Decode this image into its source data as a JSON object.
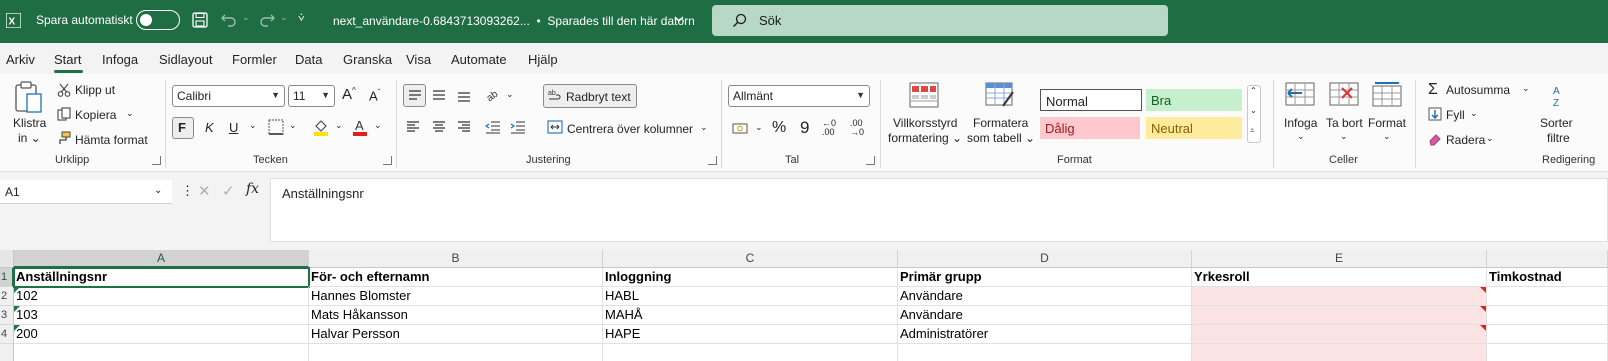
{
  "titlebar": {
    "autosave_label": "Spara automatiskt",
    "filename": "next_användare-0.6843713093262...",
    "save_status": "Sparades till den här datorn",
    "search_placeholder": "Sök"
  },
  "tabs": [
    "Arkiv",
    "Start",
    "Infoga",
    "Sidlayout",
    "Formler",
    "Data",
    "Granska",
    "Visa",
    "Automate",
    "Hjälp"
  ],
  "ribbon": {
    "clipboard": {
      "paste_label_1": "Klistra",
      "paste_label_2": "in",
      "cut": "Klipp ut",
      "copy": "Kopiera",
      "format_painter": "Hämta format",
      "group": "Urklipp"
    },
    "font": {
      "font_name": "Calibri",
      "font_size": "11",
      "bold": "F",
      "italic": "K",
      "underline": "U",
      "group": "Tecken"
    },
    "alignment": {
      "wrap_text": "Radbryt text",
      "merge_center": "Centrera över kolumner",
      "group": "Justering"
    },
    "number": {
      "format": "Allmänt",
      "percent": "%",
      "comma": "9",
      "inc_decimal": "←0 .00",
      "dec_decimal": ".00 →0",
      "group": "Tal"
    },
    "styles": {
      "conditional_1": "Villkorsstyrd",
      "conditional_2": "formatering",
      "table_1": "Formatera",
      "table_2": "som tabell",
      "normal": "Normal",
      "good": "Bra",
      "bad": "Dålig",
      "neutral": "Neutral",
      "group": "Format"
    },
    "cells": {
      "insert": "Infoga",
      "delete": "Ta bort",
      "format": "Format",
      "group": "Celler"
    },
    "editing": {
      "autosum": "Autosumma",
      "fill": "Fyll",
      "clear": "Radera",
      "sort_1": "Sorter",
      "sort_2": "filtre",
      "group": "Redigering"
    }
  },
  "formula_bar": {
    "name_box": "A1",
    "fx": "fx",
    "content": "Anställningsnr"
  },
  "grid": {
    "columns": [
      "A",
      "B",
      "C",
      "D",
      "E"
    ],
    "rows": [
      "1",
      "2",
      "3",
      "4"
    ],
    "cells": [
      [
        "Anställningsnr",
        "För- och efternamn",
        "Inloggning",
        "Primär grupp",
        "Yrkesroll",
        "Timkostnad"
      ],
      [
        "102",
        "Hannes Blomster",
        "HABL",
        "Användare",
        "",
        ""
      ],
      [
        "103",
        "Mats Håkansson",
        "MAHÅ",
        "Användare",
        "",
        ""
      ],
      [
        "200",
        "Halvar Persson",
        "HAPE",
        "Administratörer",
        "",
        ""
      ]
    ]
  },
  "colors": {
    "brand": "#1f6e43",
    "search_bg": "#b7d8c4",
    "error_fill": "#fce4e4"
  }
}
